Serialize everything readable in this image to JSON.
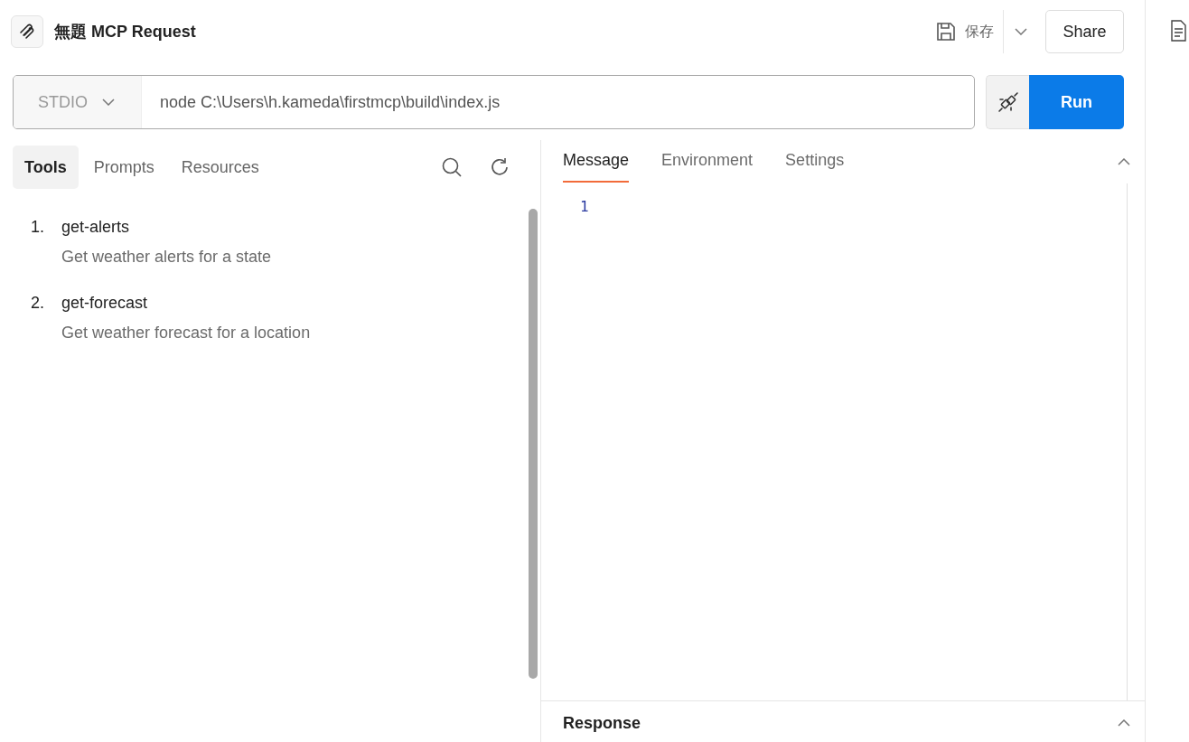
{
  "header": {
    "title": "無題 MCP Request",
    "save_label": "保存",
    "share_label": "Share"
  },
  "connection": {
    "transport": "STDIO",
    "command": "node C:\\Users\\h.kameda\\firstmcp\\build\\index.js",
    "run_label": "Run"
  },
  "left_tabs": [
    {
      "label": "Tools",
      "selected": true
    },
    {
      "label": "Prompts",
      "selected": false
    },
    {
      "label": "Resources",
      "selected": false
    }
  ],
  "tools": [
    {
      "number": "1.",
      "name": "get-alerts",
      "description": "Get weather alerts for a state"
    },
    {
      "number": "2.",
      "name": "get-forecast",
      "description": "Get weather forecast for a location"
    }
  ],
  "right_tabs": [
    {
      "label": "Message",
      "selected": true
    },
    {
      "label": "Environment",
      "selected": false
    },
    {
      "label": "Settings",
      "selected": false
    }
  ],
  "editor": {
    "line_numbers": [
      "1"
    ]
  },
  "response": {
    "title": "Response"
  }
}
